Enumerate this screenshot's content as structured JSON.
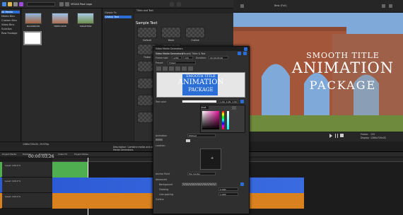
{
  "app": {
    "title": "VEGAS Post Logo"
  },
  "tree": {
    "items": [
      "All Media",
      "Media Bins",
      "Custom Bins",
      "Video Bins",
      "Subclips",
      "Raw Footage"
    ]
  },
  "media": {
    "thumbs": [
      {
        "label": "BACKDROPS"
      },
      {
        "label": "TREECURVE"
      },
      {
        "label": "TARGETNW"
      }
    ]
  },
  "fx_list": {
    "items": [
      "Classic Fx",
      "(Video) Text"
    ],
    "tabs": [
      "Explorer",
      "Transitions",
      "Video FX",
      "Media Generators"
    ]
  },
  "fx_grid": {
    "header": "Titles and Text",
    "sample_text": "Sample Text",
    "presets": [
      "Default",
      "Black",
      "Outline",
      "Tinted",
      "Standard",
      "Shadow"
    ]
  },
  "preview": {
    "toolbar_label": "Best (Full)",
    "title_line1": "SMOOTH TITLE",
    "title_line2": "ANIMATION",
    "title_line3": "PACKAGE",
    "frame_label": "Frame:",
    "frame_value": "133",
    "display_label": "Display:",
    "display_value": "1280x720x32"
  },
  "status": {
    "line1": "1280x720x32, 29.970p",
    "line2": "Description: Combine media and animated text easily",
    "line3": "Media Generators"
  },
  "timeline": {
    "timecode": "00:00:03;26",
    "tracks": [
      {
        "name": "Level: 100.0 %",
        "color": "#4fae4f"
      },
      {
        "name": "Level: 100.0 %",
        "color": "#2d5bd6"
      },
      {
        "name": "Level: 100.0 %",
        "color": "#d9811f"
      }
    ],
    "tabs": [
      "Project Media",
      "Explorer",
      "Transitions",
      "Video FX",
      "Project Notes"
    ]
  },
  "dialog": {
    "title": "Video Media Generators",
    "subtitle": "Video Media Generators",
    "effect_name": "(Moved) Titles & Text",
    "preset_label": "Preset:",
    "preset_value": "Tinted",
    "frame_size_label": "Frame size:",
    "frame_w": "1280",
    "frame_h": "720",
    "duration_label": "Duration:",
    "duration_value": "00:00:05;00",
    "preview_line1": "SMOOTH TITLE",
    "preview_line2": "ANIMATION",
    "preview_line3": "PACKAGE",
    "sections": [
      "Text color",
      "Animation",
      "Location",
      "Anchor Point",
      "Advanced",
      "Background",
      "Tracking",
      "Line spacing",
      "Outline"
    ],
    "animation_value": "Pitched",
    "anchor_value": "Top Center",
    "tracking_value": "0.000",
    "line_spacing_value": "1.000",
    "rgba": "1.00, 1.00, 1.00",
    "color_mode": "RGB"
  },
  "colors": {
    "accent": "#2b6fd6",
    "track_green": "#4fae4f",
    "track_blue": "#2d5bd6",
    "track_orange": "#d9811f"
  }
}
